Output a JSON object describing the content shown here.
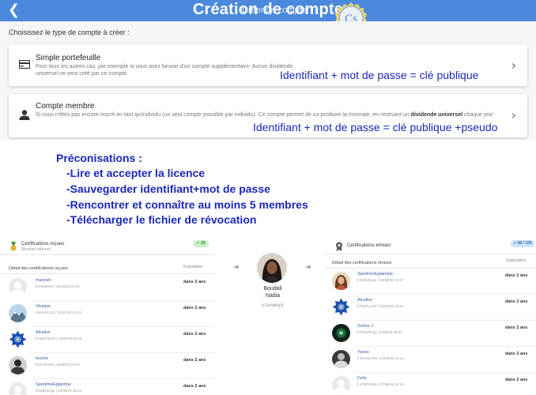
{
  "header": {
    "back_icon": "back-arrow-icon",
    "faded_title": "Créer un compte",
    "title": "Création de compte",
    "logo_text": "Cs"
  },
  "choose_label": "Choisissez le type de compte à créer :",
  "cards": [
    {
      "title": "Simple portefeuille",
      "desc": "Pour tous les autres cas, par exemple si vous avez besoin d'un compte supplémentaire. Aucun dividende universel ne sera créé par ce compte.",
      "icon": "wallet-icon",
      "annotation": "Identifiant + mot de passe = clé publique"
    },
    {
      "title": "Compte membre",
      "desc_a": "Si vous n'êtes pas encore inscrit en tant qu'individu (un seul compte possible par individu). Ce compte permet de co-produire la monnaie, en recevant un",
      "desc_b": "dividende universel",
      "desc_c": "chaque jour.",
      "icon": "person-icon",
      "annotation": "Identifiant + mot de passe = clé publique +pseudo"
    }
  ],
  "preconisations": {
    "title": "Préconisations :",
    "items": [
      "-Lire et accepter la licence",
      "-Sauvegarder identifiant+mot de passe",
      "-Rencontrer et connaître au moins 5 membres",
      "-Télécharger le fichier de révocation"
    ]
  },
  "received": {
    "title": "Certifications reçues",
    "subtitle": "Membre référent",
    "badge": "✓ 25",
    "detail_header": "Détail des certifications reçues",
    "exp_header": "Expiration",
    "rows": [
      {
        "name": "marysel",
        "meta": "ℹ D5Sd8zD | 15/10/19 19:16",
        "exp": "dans 2 ans",
        "avatar": "default"
      },
      {
        "name": "Vivakvo",
        "meta": "ℹ 6eUdA1dz | 03/10/19 21:43",
        "exp": "dans 2 ans",
        "avatar": "mountain"
      },
      {
        "name": "Alcalive",
        "meta": "ℹ FQdAJyeP | 21/09/19 20:28",
        "exp": "dans 2 ans",
        "avatar": "mandala"
      },
      {
        "name": "hocine",
        "meta": "ℹ Ex7khNxt | 19/09/19 21:04",
        "exp": "dans 2 ans",
        "avatar": "bw-person"
      },
      {
        "name": "SandrineEglantine",
        "meta": "ℹ DbbQhvg2 | 03/09/19 15:24",
        "exp": "dans 2 ans",
        "avatar": "default"
      }
    ]
  },
  "profile": {
    "name_line1": "Boudali",
    "name_line2": "Nadia",
    "key": "ℹ GvYqNcp3"
  },
  "emitted": {
    "title": "Certifications émises",
    "badge": "✓ 56 / 100",
    "detail_header": "Détail des certifications émises",
    "exp_header": "Expiration",
    "rows": [
      {
        "name": "SandrineEglantine",
        "meta": "ℹ DbbQhvg2 | 28/08/19 13:37",
        "exp": "dans 2 ans",
        "avatar": "woman"
      },
      {
        "name": "Alcalive",
        "meta": "ℹ FQdAJyeP | 24/08/19 12:24",
        "exp": "dans 2 ans",
        "avatar": "mandala"
      },
      {
        "name": "Zoriko-J",
        "meta": "ℹ FwbeRcqj | 23/08/19 09:34",
        "exp": "dans 2 ans",
        "avatar": "dark-green"
      },
      {
        "name": "Yanoc",
        "meta": "ℹ 9A9SuAKK | 27/08/19 21:41",
        "exp": "dans 2 ans",
        "avatar": "bw-person"
      },
      {
        "name": "Felix",
        "meta": "ℹ 47BTXSd1 | 17/08/19 12:18",
        "exp": "dans 2 ans",
        "avatar": "default"
      }
    ]
  },
  "colors": {
    "header_bg": "#4a89dc",
    "annotation": "#1b27b8",
    "name_link": "#3a5ba8"
  }
}
